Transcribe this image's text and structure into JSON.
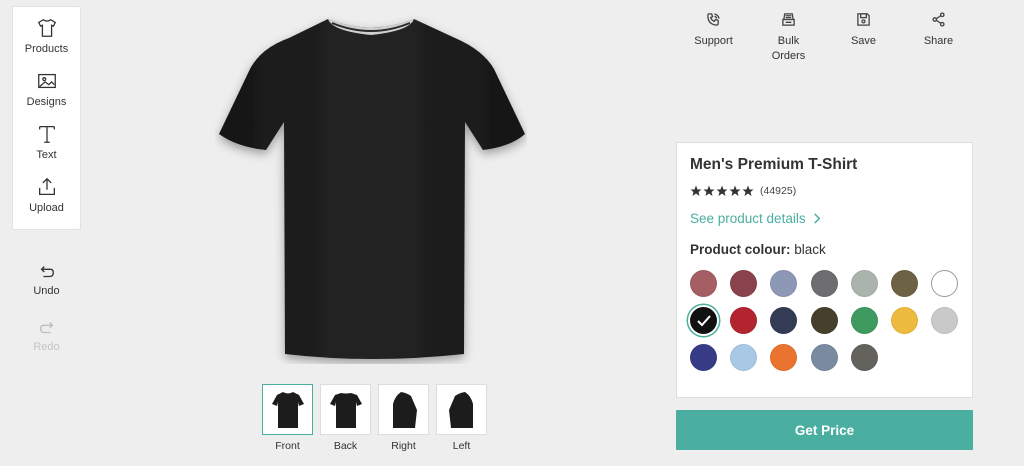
{
  "toolbar": {
    "items": [
      {
        "label": "Products",
        "icon": "tshirt-icon"
      },
      {
        "label": "Designs",
        "icon": "image-icon"
      },
      {
        "label": "Text",
        "icon": "text-icon"
      },
      {
        "label": "Upload",
        "icon": "upload-icon"
      }
    ],
    "undo_label": "Undo",
    "redo_label": "Redo"
  },
  "views": [
    {
      "label": "Front",
      "active": true
    },
    {
      "label": "Back",
      "active": false
    },
    {
      "label": "Right",
      "active": false
    },
    {
      "label": "Left",
      "active": false
    }
  ],
  "actions": [
    {
      "label": "Support",
      "icon": "phone-icon"
    },
    {
      "label": "Bulk\nOrders",
      "icon": "bulk-icon"
    },
    {
      "label": "Save",
      "icon": "save-icon"
    },
    {
      "label": "Share",
      "icon": "share-icon"
    }
  ],
  "product": {
    "name": "Men's Premium T-Shirt",
    "rating_stars": 5,
    "reviews": "(44925)",
    "details_link": "See product details",
    "colour_label": "Product colour:",
    "colour_value": "black",
    "swatches": [
      "#a55e63",
      "#8a424d",
      "#8d97b6",
      "#6e6e70",
      "#aab4ad",
      "#6d6243",
      "#ffffff",
      "#111111",
      "#b2242f",
      "#333b55",
      "#463f2c",
      "#3e9a5f",
      "#ecbb3e",
      "#c9c9c9",
      "#373b86",
      "#a9c8e6",
      "#ea732f",
      "#7a8b9f",
      "#64625d"
    ],
    "selected_index": 7
  },
  "cta": {
    "label": "Get Price"
  },
  "colors": {
    "accent": "#4aaea0",
    "shirt": "#1f1f1f"
  }
}
